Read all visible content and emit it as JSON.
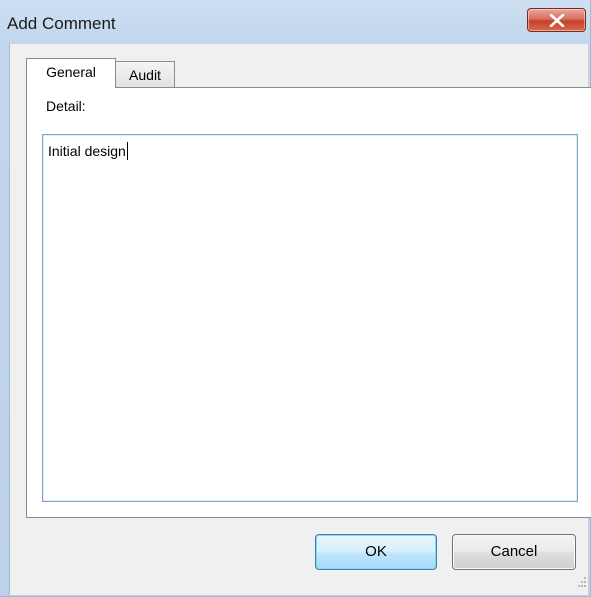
{
  "window": {
    "title": "Add Comment",
    "close_icon": "close-x-icon"
  },
  "tabs": [
    {
      "label": "General",
      "selected": true
    },
    {
      "label": "Audit",
      "selected": false
    }
  ],
  "general": {
    "detail_label": "Detail:",
    "detail_value": "Initial design"
  },
  "buttons": {
    "ok": "OK",
    "cancel": "Cancel"
  },
  "colors": {
    "close_button": "#c4402a",
    "ok_border": "#3c7fb1",
    "field_border": "#7fa3c8"
  }
}
